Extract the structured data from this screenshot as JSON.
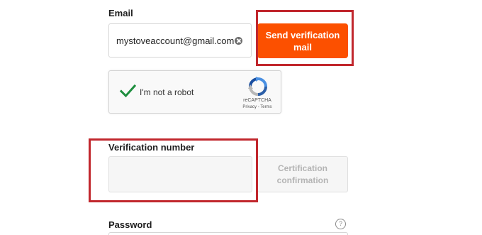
{
  "email": {
    "label": "Email",
    "value": "mystoveaccount@gmail.com",
    "send_button_label": "Send verification mail"
  },
  "captcha": {
    "label": "I'm not a robot",
    "brand": "reCAPTCHA",
    "links": "Privacy - Terms"
  },
  "verification": {
    "label": "Verification number",
    "value": "",
    "confirm_button_label": "Certification confirmation"
  },
  "password": {
    "label": "Password"
  },
  "colors": {
    "accent": "#fc5000",
    "highlight_frame": "#c1272d",
    "check": "#1e8e3e"
  }
}
